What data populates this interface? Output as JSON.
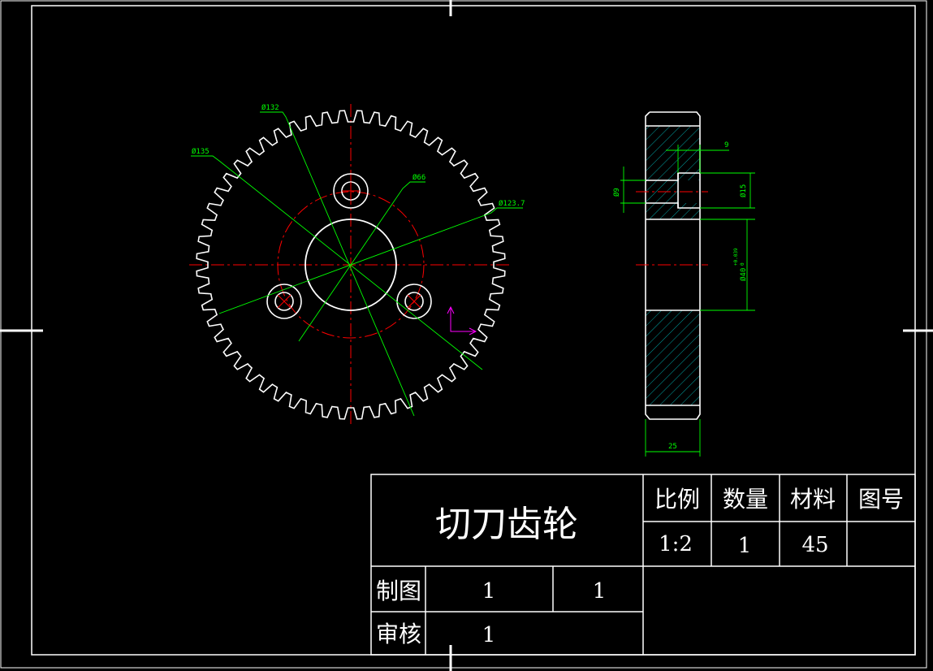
{
  "drawing": {
    "dimensions": {
      "d132": "Ø132",
      "d135": "Ø135",
      "d66": "Ø66",
      "d123_7": "Ø123.7",
      "w9": "9",
      "d9": "Ø9",
      "d15": "Ø15",
      "d40": "Ø40",
      "d40_tol_upper": "+0.039",
      "d40_tol_lower": "0",
      "w25": "25"
    }
  },
  "title_block": {
    "title": "切刀齿轮",
    "headers": {
      "scale": "比例",
      "qty": "数量",
      "material": "材料",
      "drawing_no": "图号"
    },
    "values": {
      "scale": "1:2",
      "qty": "1",
      "material": "45",
      "drawing_no": ""
    },
    "rows": {
      "drawn_label": "制图",
      "drawn_value1": "1",
      "drawn_value2": "1",
      "checked_label": "审核",
      "checked_value1": "1",
      "checked_value2": ""
    }
  },
  "colors": {
    "outline": "#ffffff",
    "center_line": "#ff0000",
    "dimension": "#00ff00",
    "hatch": "#00cccc",
    "ucs": "#ff00ff"
  }
}
